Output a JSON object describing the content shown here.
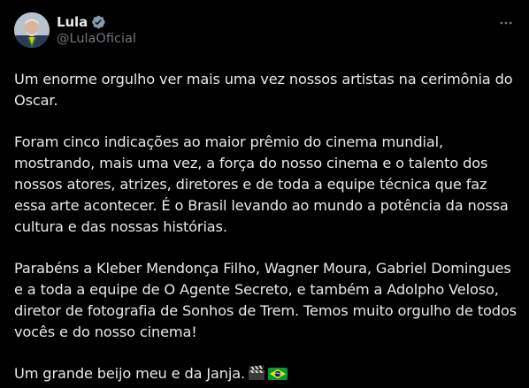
{
  "author": {
    "display_name": "Lula",
    "handle": "@LulaOficial",
    "verified": true
  },
  "tweet": {
    "paragraphs": [
      "Um enorme orgulho ver mais uma vez nossos artistas na cerimônia do Oscar.",
      "Foram cinco indicações ao maior prêmio do cinema mundial, mostrando, mais uma vez, a força do nosso cinema e o talento dos nossos atores, atrizes, diretores e de toda a equipe técnica que faz essa arte acontecer. É o Brasil levando ao mundo a potência da nossa cultura e das nossas histórias.",
      "Parabéns a Kleber Mendonça Filho, Wagner Moura, Gabriel Domingues e a toda a equipe de O Agente Secreto, e também a Adolpho Veloso, diretor de fotografia de Sonhos de Trem. Temos muito orgulho de todos vocês e do nosso cinema!",
      "Um grande beijo meu e da Janja."
    ],
    "emojis": [
      "clapper-board-icon",
      "brazil-flag-icon"
    ]
  },
  "colors": {
    "background": "#000000",
    "text": "#e7e9ea",
    "secondary_text": "#71767b",
    "verified_badge": "#829aab"
  }
}
